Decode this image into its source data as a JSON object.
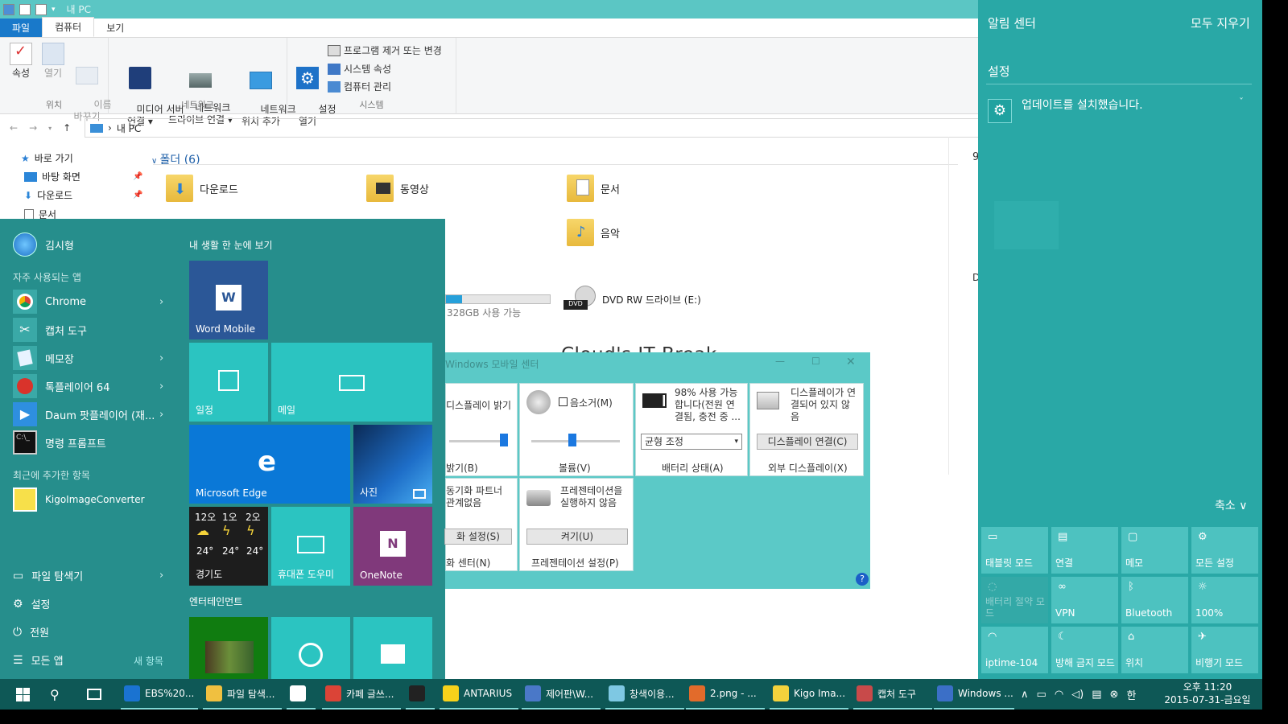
{
  "explorer": {
    "title": "내 PC",
    "tabs": [
      "파일",
      "컴퓨터",
      "보기"
    ],
    "ribbon": {
      "location": {
        "label": "위치",
        "properties": "속성",
        "open": "열기",
        "rename": "이름\n바꾸기"
      },
      "network": {
        "label": "네트워크",
        "media_server": "미디어 서버\n연결 ▾",
        "map_drive": "네트워크\n드라이브 연결 ▾",
        "add_location": "네트워크\n위치 추가"
      },
      "system": {
        "label": "시스템",
        "open_settings": "설정\n열기",
        "uninstall": "프로그램 제거 또는 변경",
        "sys_props": "시스템 속성",
        "manage": "컴퓨터 관리"
      }
    },
    "address": {
      "path": "내 PC"
    },
    "nav": {
      "quick_access": "바로 가기",
      "items": [
        "바탕 화면",
        "다운로드",
        "문서"
      ]
    },
    "folders_header": "폴더 (6)",
    "folders": [
      "다운로드",
      "동영상",
      "문서",
      "음악"
    ],
    "drive_free": "328GB 사용 가능",
    "dvd": "DVD RW 드라이브 (E:)",
    "right_edge_chars": [
      "9",
      "D"
    ]
  },
  "watermark": "Cloud's IT Break",
  "start": {
    "user": "김시형",
    "most_used_header": "자주 사용되는 앱",
    "apps": [
      "Chrome",
      "캡처 도구",
      "메모장",
      "톡플레이어 64",
      "Daum 팟플레이어 (재...",
      "명령 프롬프트"
    ],
    "recent_header": "최근에 추가한 항목",
    "recent": [
      "KigoImageConverter"
    ],
    "bottom": [
      "파일 탐색기",
      "설정",
      "전원",
      "모든 앱"
    ],
    "new_items": "새 항목",
    "tiles_header": "내 생활 한 눈에 보기",
    "tiles": {
      "word": "Word Mobile",
      "calendar": "일정",
      "mail": "메일",
      "edge": "Microsoft Edge",
      "photos": "사진",
      "weather_days": [
        "12오",
        "1오",
        "2오"
      ],
      "weather_temps": [
        "24°",
        "24°",
        "24°"
      ],
      "weather_loc": "경기도",
      "phone": "휴대폰 도우미",
      "onenote": "OneNote"
    },
    "entertainment_header": "엔터테인먼트"
  },
  "mobility": {
    "title": "Windows 모바일 센터",
    "brightness": {
      "label": "디스플레이 밝기",
      "footer": "밝기(B)"
    },
    "volume": {
      "mute": "음소거(M)",
      "footer": "볼륨(V)"
    },
    "battery": {
      "status": "98% 사용 가능\n합니다(전원 연\n결됨, 충전 중 ...",
      "select": "균형 조정",
      "footer": "배터리 상태(A)"
    },
    "display": {
      "status": "디스플레이가 연\n결되어 있지 않\n음",
      "button": "디스플레이 연결(C)",
      "footer": "외부 디스플레이(X)"
    },
    "sync": {
      "status": "동기화 파트너\n관계없음",
      "button": "화 설정(S)",
      "footer": "화 센터(N)"
    },
    "presentation": {
      "status": "프레젠테이션을\n실행하지 않음",
      "button": "켜기(U)",
      "footer": "프레젠테이션 설정(P)"
    }
  },
  "action_center": {
    "title": "알림 센터",
    "clear_all": "모두 지우기",
    "section": "설정",
    "notification": "업데이트를 설치했습니다.",
    "collapse": "축소",
    "quick_actions": [
      {
        "label": "태블릿 모드",
        "icon": "▭",
        "on": true
      },
      {
        "label": "연결",
        "icon": "▤",
        "on": true
      },
      {
        "label": "메모",
        "icon": "▢",
        "on": true
      },
      {
        "label": "모든 설정",
        "icon": "⚙",
        "on": true
      },
      {
        "label": "배터리 절약 모\n드",
        "icon": "◌",
        "on": false
      },
      {
        "label": "VPN",
        "icon": "∞",
        "on": true
      },
      {
        "label": "Bluetooth",
        "icon": "ᛒ",
        "on": true
      },
      {
        "label": "100%",
        "icon": "☼",
        "on": true
      },
      {
        "label": "iptime-104",
        "icon": "◠",
        "on": true
      },
      {
        "label": "방해 금지 모드",
        "icon": "☾",
        "on": true
      },
      {
        "label": "위치",
        "icon": "⌂",
        "on": true
      },
      {
        "label": "비행기 모드",
        "icon": "✈",
        "on": true
      }
    ]
  },
  "taskbar": {
    "items": [
      {
        "label": "EBS%20...",
        "color": "#1a73d1"
      },
      {
        "label": "파일 탐색...",
        "color": "#f0c040"
      },
      {
        "label": "",
        "color": "#ffffff"
      },
      {
        "label": "카페 글쓰...",
        "color": "#db4437"
      },
      {
        "label": "",
        "color": "#222222"
      },
      {
        "label": "ANTARIUS",
        "color": "#f7d21b"
      },
      {
        "label": "제어판\\W...",
        "color": "#4a78c8"
      },
      {
        "label": "창색이용...",
        "color": "#7ec8e3"
      },
      {
        "label": "2.png - ...",
        "color": "#e26b2b"
      },
      {
        "label": "Kigo Ima...",
        "color": "#f3d23c"
      },
      {
        "label": "캡처 도구",
        "color": "#c84a4a"
      },
      {
        "label": "Windows ...",
        "color": "#3b6fc7"
      }
    ],
    "time": "오후 11:20",
    "date": "2015-07-31-금요일",
    "ime": "한"
  }
}
